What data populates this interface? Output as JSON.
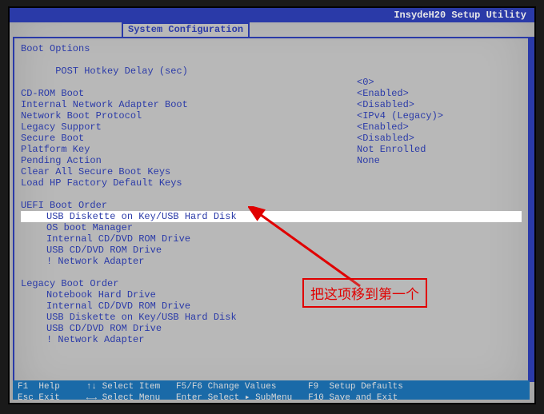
{
  "utility_title": "InsydeH20 Setup Utility",
  "tab_label": "System Configuration",
  "section1": {
    "boot_options": "Boot Options",
    "post_hotkey": "POST Hotkey Delay (sec)",
    "post_hotkey_val": "<0>"
  },
  "settings": [
    {
      "label": "CD-ROM Boot",
      "value": "<Enabled>"
    },
    {
      "label": "Internal Network Adapter Boot",
      "value": "<Disabled>"
    },
    {
      "label": "Network Boot Protocol",
      "value": "<IPv4 (Legacy)>"
    },
    {
      "label": "Legacy Support",
      "value": "<Enabled>"
    },
    {
      "label": "Secure Boot",
      "value": "<Disabled>"
    },
    {
      "label": "Platform Key",
      "value": "Not Enrolled"
    },
    {
      "label": "Pending Action",
      "value": "None"
    },
    {
      "label": "Clear All Secure Boot Keys",
      "value": ""
    },
    {
      "label": "Load HP Factory Default Keys",
      "value": ""
    }
  ],
  "uefi": {
    "header": "UEFI Boot Order",
    "items": [
      "USB Diskette on Key/USB Hard Disk",
      "OS boot Manager",
      "Internal CD/DVD ROM Drive",
      "USB CD/DVD ROM Drive",
      "! Network Adapter"
    ],
    "selected_index": 0
  },
  "legacy": {
    "header": "Legacy Boot Order",
    "items": [
      "Notebook Hard Drive",
      "Internal CD/DVD ROM Drive",
      "USB Diskette on Key/USB Hard Disk",
      "USB CD/DVD ROM Drive",
      "! Network Adapter"
    ]
  },
  "footer": "F1  Help     ↑↓ Select Item   F5/F6 Change Values      F9  Setup Defaults\nEsc Exit     ←→ Select Menu   Enter Select ▸ SubMenu   F10 Save and Exit",
  "annotation": "把这项移到第一个"
}
